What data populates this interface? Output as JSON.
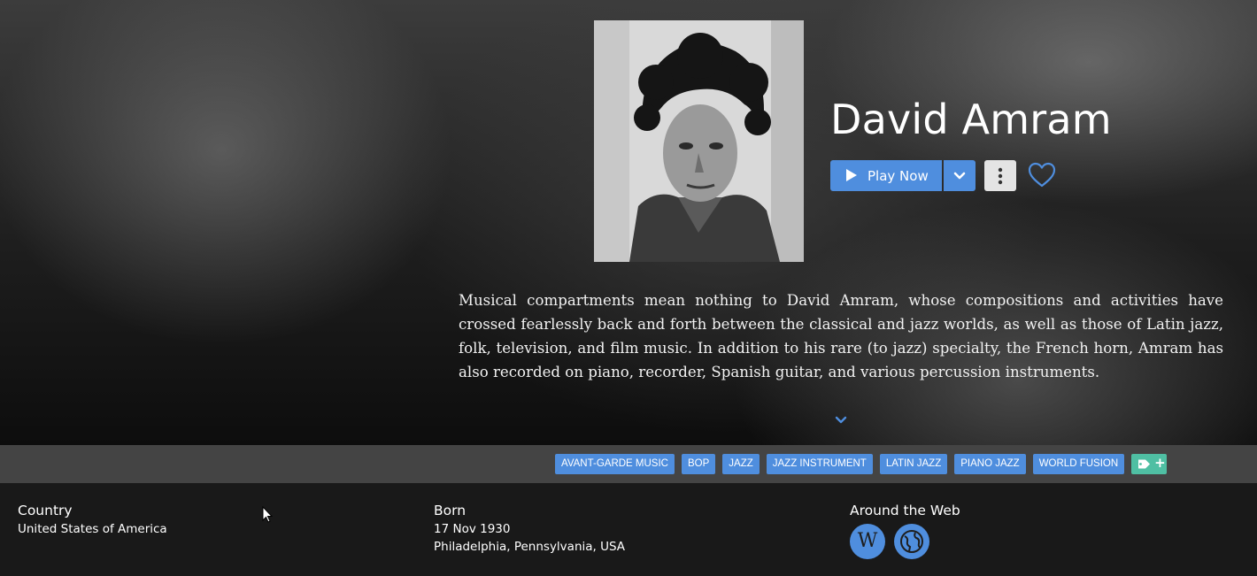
{
  "artist": {
    "name": "David Amram",
    "photo_alt": "artist-photo",
    "bio": "Musical compartments mean nothing to David Amram, whose compositions and activities have crossed fearlessly back and forth between the classical and jazz worlds, as well as those of Latin jazz, folk, television, and film music. In addition to his rare (to jazz) specialty, the French horn, Amram has also recorded on piano, recorder, Spanish guitar, and various percussion instruments."
  },
  "actions": {
    "play_label": "Play Now",
    "play_icon": "play-icon",
    "dropdown_icon": "chevron-down-icon",
    "more_icon": "more-vertical-icon",
    "favorite_icon": "heart-icon",
    "expand_icon": "chevron-down-icon"
  },
  "tags": [
    "AVANT-GARDE MUSIC",
    "BOP",
    "JAZZ",
    "JAZZ INSTRUMENT",
    "LATIN JAZZ",
    "PIANO JAZZ",
    "WORLD FUSION"
  ],
  "tag_add": {
    "icon": "tag-icon",
    "symbol": "+"
  },
  "info": {
    "country": {
      "heading": "Country",
      "value": "United States of America"
    },
    "born": {
      "heading": "Born",
      "date": "17 Nov 1930",
      "place": "Philadelphia, Pennsylvania, USA"
    },
    "web": {
      "heading": "Around the Web",
      "wikipedia_glyph": "W",
      "links": [
        "wikipedia-icon",
        "globe-icon"
      ]
    }
  },
  "colors": {
    "accent": "#4f8ede",
    "tag_add": "#4fbfa3",
    "tag_bar": "#444444",
    "info_bg": "#191919"
  }
}
